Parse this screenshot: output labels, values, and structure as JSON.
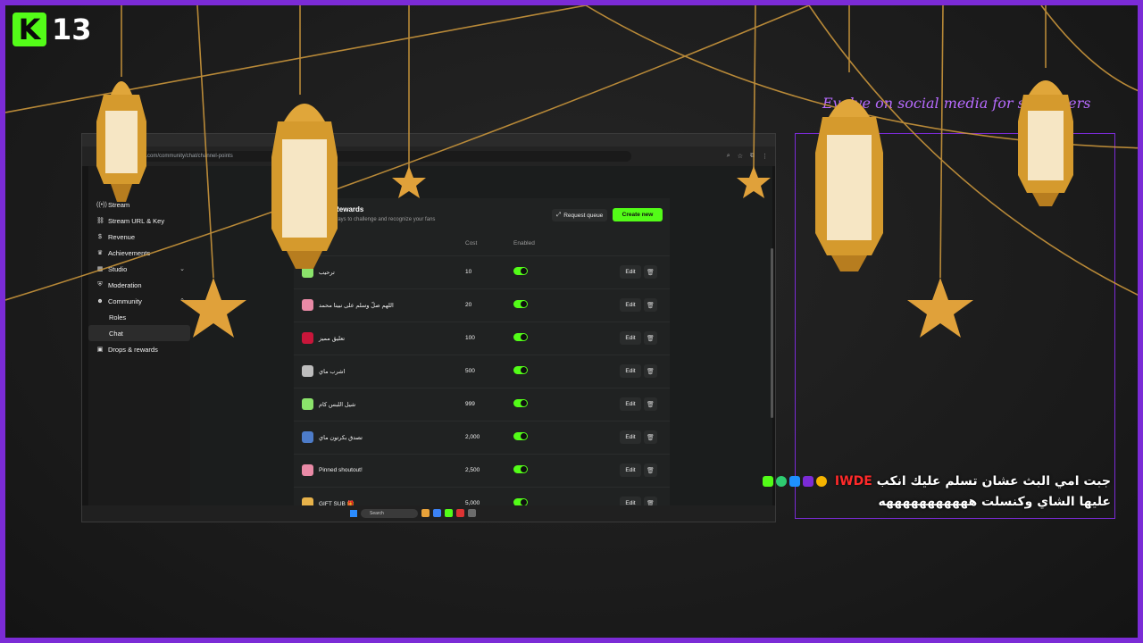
{
  "overlay": {
    "badge_logo": "K",
    "badge_number": "13",
    "tagline": "Evolve on social media for streamers",
    "accent_color": "#7b2bd6",
    "brand_green": "#53fc18"
  },
  "browser": {
    "url": "kick.com/community/chat/channel-points"
  },
  "sidebar": {
    "items": [
      {
        "label": "Stream",
        "icon": "broadcast-icon"
      },
      {
        "label": "Stream URL & Key",
        "icon": "link-icon"
      },
      {
        "label": "Revenue",
        "icon": "dollar-icon"
      },
      {
        "label": "Achievements",
        "icon": "trophy-icon"
      },
      {
        "label": "Studio",
        "icon": "film-icon"
      },
      {
        "label": "Moderation",
        "icon": "shield-icon"
      },
      {
        "label": "Community",
        "icon": "users-icon"
      },
      {
        "label": "Roles",
        "icon": ""
      },
      {
        "label": "Chat",
        "icon": ""
      },
      {
        "label": "Drops & rewards",
        "icon": "gift-icon"
      }
    ]
  },
  "rewards": {
    "title": "Rewards",
    "subtitle": "ways to challenge and recognize your fans",
    "request_queue_label": "Request queue",
    "create_new_label": "Create new",
    "col_cost": "Cost",
    "col_enabled": "Enabled",
    "edit_label": "Edit",
    "rows": [
      {
        "name": "ترحيب",
        "cost": "10",
        "color": "#8be36b"
      },
      {
        "name": "اللهم صلّ وسلم على نبينا محمد",
        "cost": "20",
        "color": "#e98aa6"
      },
      {
        "name": "تعليق مميز",
        "cost": "100",
        "color": "#c8163a"
      },
      {
        "name": "اشرب ماي",
        "cost": "500",
        "color": "#bdbdbd"
      },
      {
        "name": "شيل اللبس كام",
        "cost": "999",
        "color": "#8be36b"
      },
      {
        "name": "تصدق بكرتون ماي",
        "cost": "2,000",
        "color": "#4d7cc9"
      },
      {
        "name": "Pinned shoutout!",
        "cost": "2,500",
        "color": "#e98aa6"
      },
      {
        "name": "GIFT SUB 🎁",
        "cost": "5,000",
        "color": "#e7b24a"
      }
    ]
  },
  "taskbar": {
    "search_placeholder": "Search"
  },
  "alert": {
    "username": "IWDE",
    "message_line1": "جبت امي البث عشان تسلم عليك انكب",
    "message_line2": "عليها الشاي وكنسلت هههههههههههه"
  }
}
